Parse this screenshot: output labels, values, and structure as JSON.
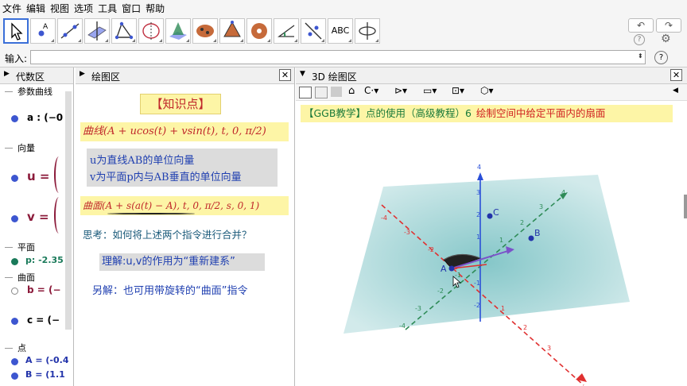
{
  "menu": [
    "文件",
    "编辑",
    "视图",
    "选项",
    "工具",
    "窗口",
    "帮助"
  ],
  "toolbar": {
    "tools": [
      {
        "name": "move-tool-icon"
      },
      {
        "name": "point-tool-icon"
      },
      {
        "name": "line-tool-icon"
      },
      {
        "name": "perpendicular-line-tool-icon"
      },
      {
        "name": "polygon-tool-icon"
      },
      {
        "name": "circle-tool-icon"
      },
      {
        "name": "intersect-tool-icon"
      },
      {
        "name": "plane-tool-icon"
      },
      {
        "name": "pyramid-tool-icon"
      },
      {
        "name": "sphere-tool-icon"
      },
      {
        "name": "angle-tool-icon"
      },
      {
        "name": "reflect-tool-icon"
      },
      {
        "name": "text-tool-icon",
        "label": "ABC"
      },
      {
        "name": "rotate-view-tool-icon"
      }
    ],
    "undo_label": "↶",
    "redo_label": "↷",
    "settings_icon": "gear-icon",
    "help_icon": "help-icon"
  },
  "input": {
    "label": "输入:",
    "value": "",
    "help": "?"
  },
  "algebra": {
    "title": "代数区",
    "categories": [
      {
        "label": "参数曲线"
      },
      {
        "label": "向量"
      },
      {
        "label": "平面"
      },
      {
        "label": "曲面"
      },
      {
        "label": "点"
      }
    ],
    "items": [
      {
        "text": "a : (−0",
        "color": "#000000"
      },
      {
        "text": "u =",
        "color": "#8b1a3a"
      },
      {
        "text": "v =",
        "color": "#8b1a3a"
      },
      {
        "text": "p: -2.35",
        "color": "#1a7a5a"
      },
      {
        "text": "b = (−",
        "color": "#8b1a3a"
      },
      {
        "text": "c = (−",
        "color": "#000000"
      },
      {
        "text": "A = (-0.4",
        "color": "#2233aa"
      },
      {
        "text": "B = (1.1",
        "color": "#2233aa"
      }
    ]
  },
  "graphics": {
    "title": "绘图区",
    "heading": "【知识点】",
    "curve_cmd": "曲线(A + ucos(t) + vsin(t), t, 0, π/2)",
    "note_u": "u为直线AB的单位向量",
    "note_v": "v为平面p内与AB垂直的单位向量",
    "surface_cmd": "曲面(A + s(a(t) − A), t, 0, π/2, s, 0, 1)",
    "question": "思考：如何将上述两个指令进行合并？",
    "answer1": "理解:u,v的作用为“重新建系”",
    "answer2": "另解：也可用带旋转的“曲面”指令"
  },
  "g3d": {
    "title": "3D 绘图区",
    "banner_left": "【GGB教学】点的使用（高级教程）6",
    "banner_right": "绘制空间中给定平面内的扇面",
    "points": {
      "A": "A",
      "B": "B",
      "C": "C"
    },
    "z_ticks": [
      "4",
      "3",
      "2",
      "1",
      "-1",
      "-2"
    ],
    "x_ticks": [
      "-4",
      "-3",
      "-2",
      "-1",
      "1",
      "2",
      "3",
      "4"
    ],
    "y_ticks": [
      "-4",
      "-3",
      "-2",
      "-1",
      "1",
      "2",
      "3",
      "4"
    ],
    "colors": {
      "plane": "#7fc4c6",
      "x_axis": "#e03030",
      "y_axis": "#2e8b57",
      "z_axis": "#2a4fd8",
      "vector": "#7b52c9",
      "sector": "#222222"
    }
  }
}
